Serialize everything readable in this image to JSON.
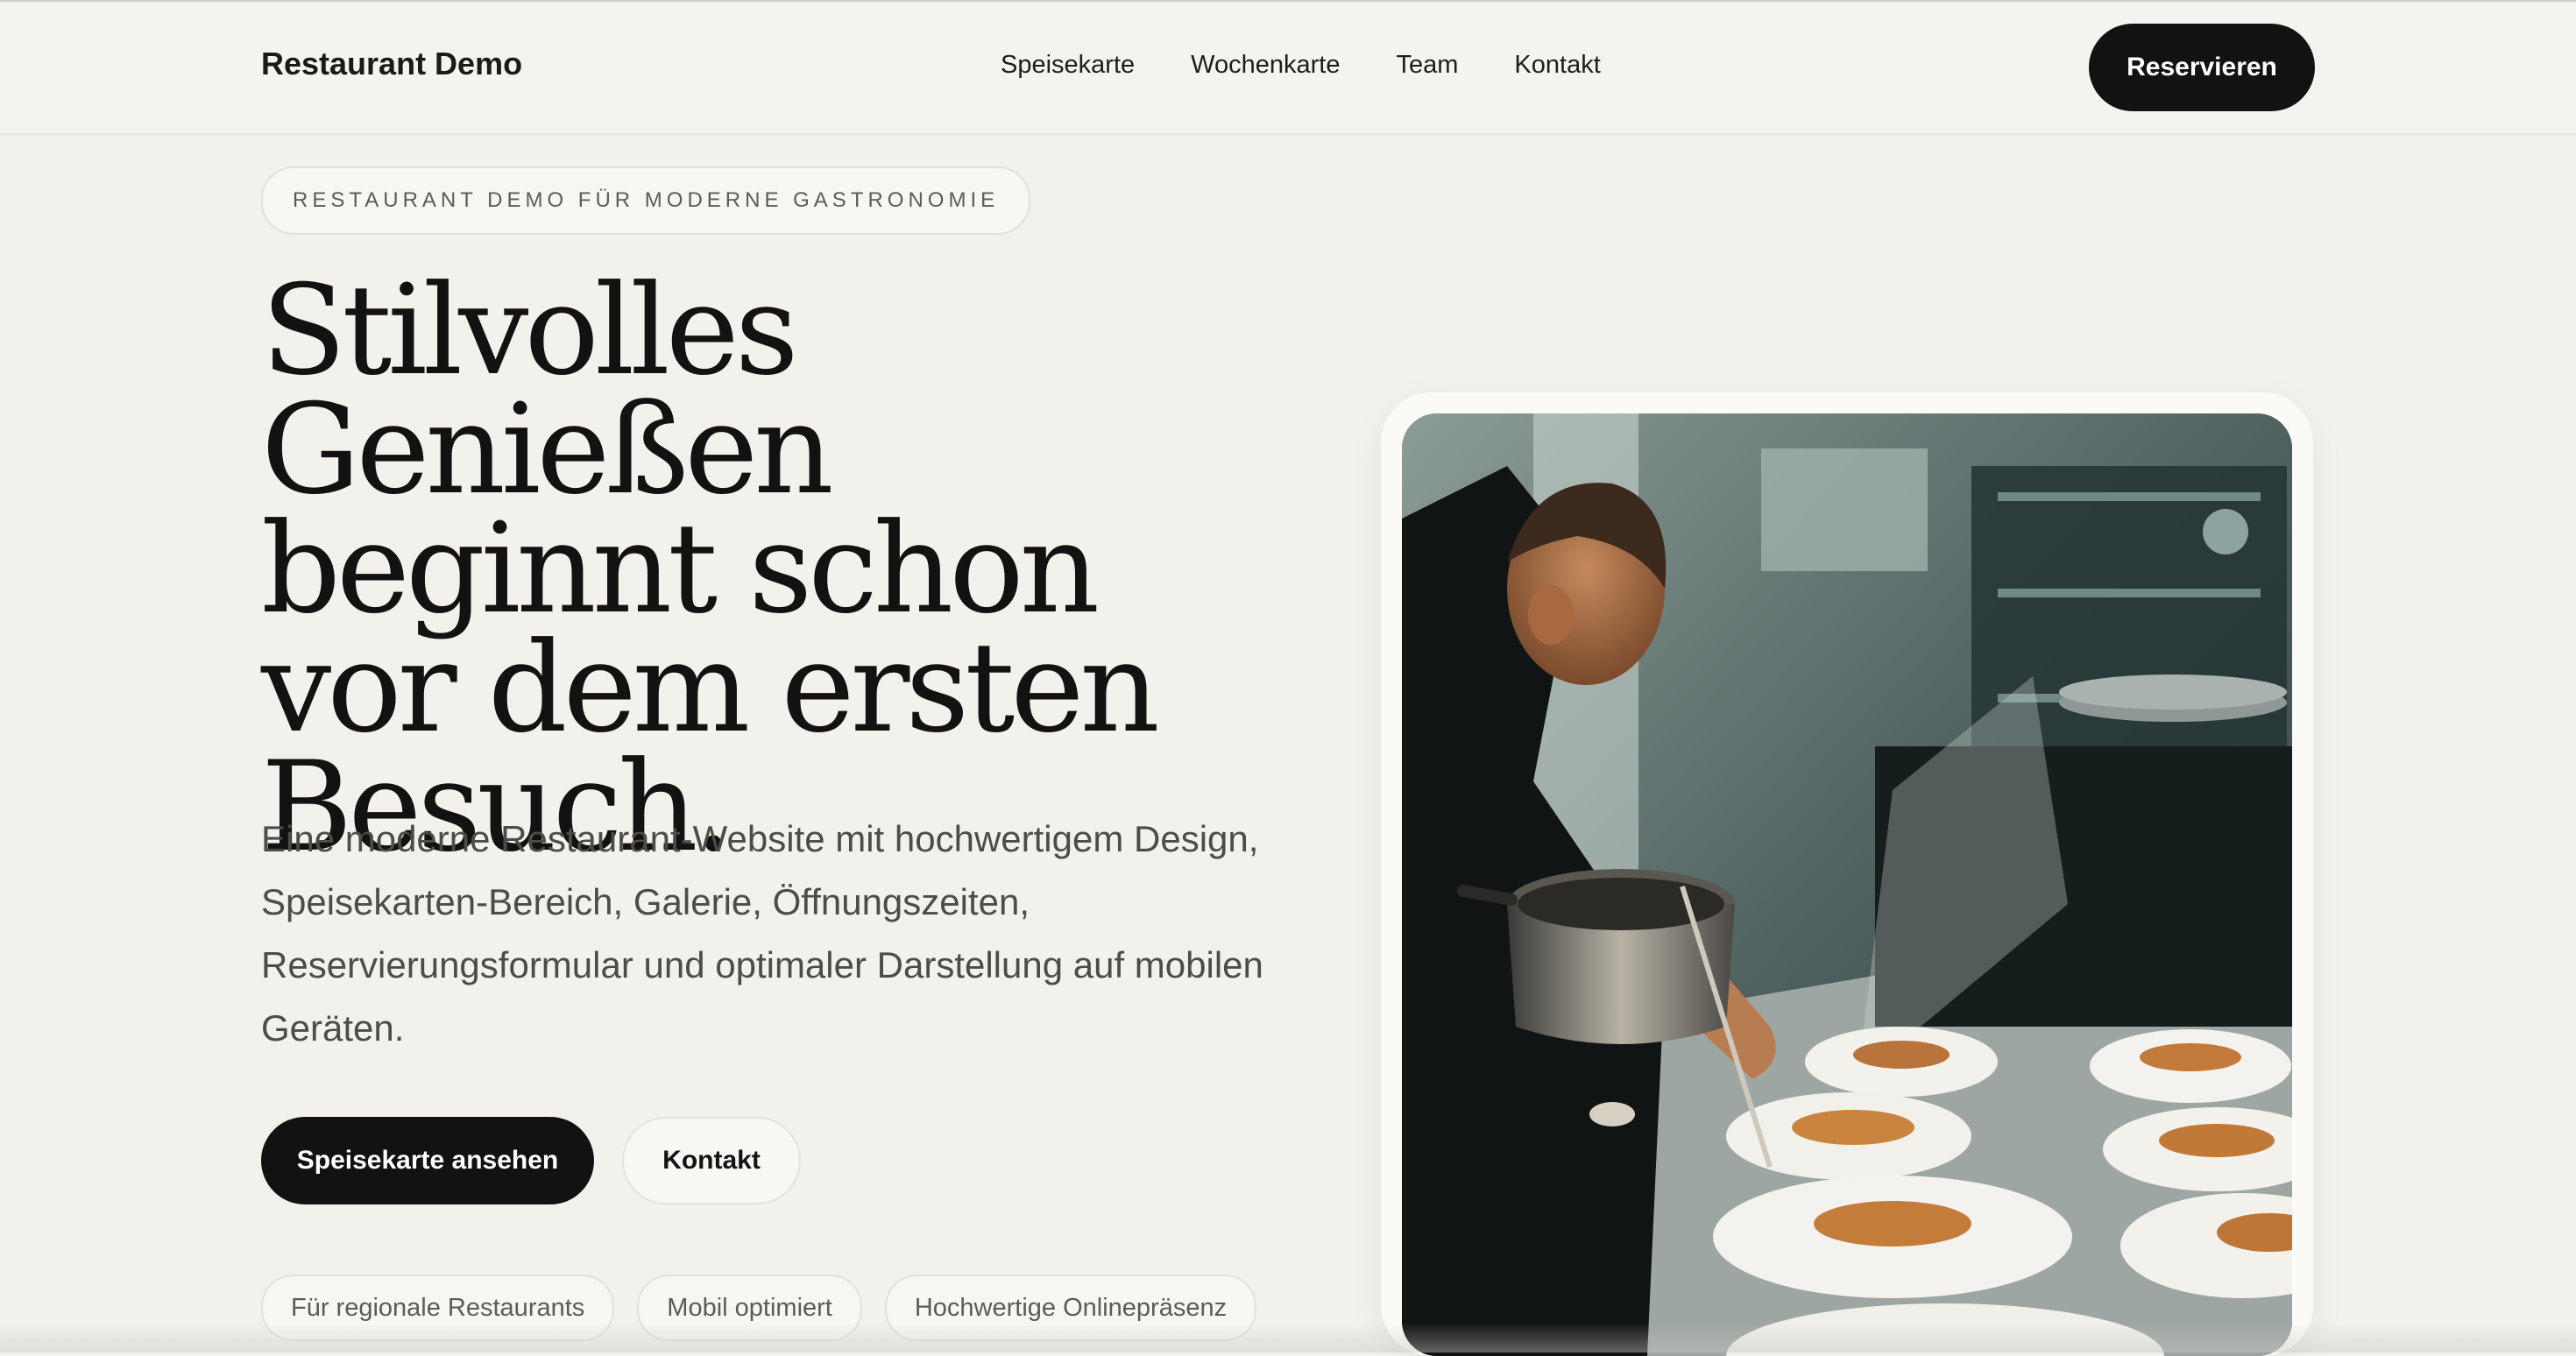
{
  "header": {
    "brand": "Restaurant Demo",
    "nav": [
      "Speisekarte",
      "Wochenkarte",
      "Team",
      "Kontakt"
    ],
    "cta": "Reservieren"
  },
  "hero": {
    "eyebrow": "RESTAURANT DEMO FÜR MODERNE GASTRONOMIE",
    "title_lines": [
      "Stilvolles Genießen",
      "beginnt schon",
      "vor dem ersten",
      "Besuch."
    ],
    "lead": "Eine moderne Restaurant-Website mit hochwertigem Design, Speisekarten-Bereich, Galerie, Öffnungszeiten, Reservierungsformular und optimaler Darstellung auf mobilen Geräten.",
    "primary_button": "Speisekarte ansehen",
    "secondary_button": "Kontakt",
    "tags": [
      "Für regionale Restaurants",
      "Mobil optimiert",
      "Hochwertige Onlinepräsenz"
    ]
  },
  "colors": {
    "background": "#f3f1ec",
    "dark_button": "#121212",
    "text": "#141414"
  }
}
